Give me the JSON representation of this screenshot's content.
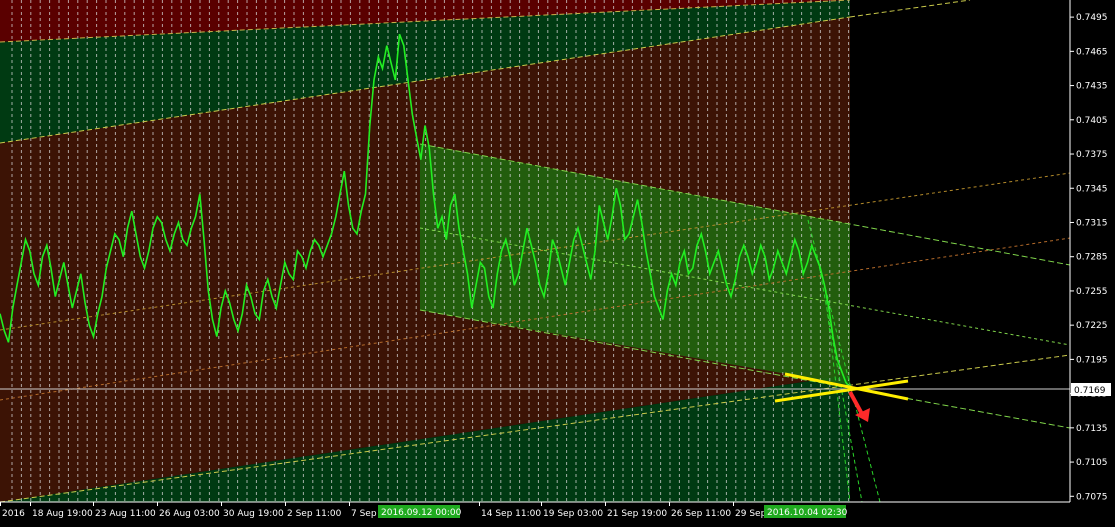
{
  "chart_data": {
    "type": "line",
    "instrument_series": "price",
    "ylim": [
      0.707,
      0.751
    ],
    "y_ticks": [
      "0.7495",
      "0.7465",
      "0.7435",
      "0.7405",
      "0.7375",
      "0.7345",
      "0.7315",
      "0.7285",
      "0.7255",
      "0.7225",
      "0.7195",
      "0.7165",
      "0.7135",
      "0.7105",
      "0.7075"
    ],
    "current_price": "0.7169",
    "x_ticks": [
      "2016",
      "18 Aug 19:00",
      "23 Aug 11:00",
      "26 Aug 03:00",
      "30 Aug 19:00",
      "2 Sep 11:00",
      "7 Sep 0",
      "14 Sep 11:00",
      "19 Sep 03:00",
      "21 Sep 19:00",
      "26 Sep 11:00",
      "29 Sep"
    ],
    "x_highlight_tags": [
      "2016.09.12 00:00",
      "2016.10.04 02:30"
    ],
    "grid": "vertical dashed",
    "price_y": [
      0.7235,
      0.722,
      0.721,
      0.724,
      0.726,
      0.728,
      0.73,
      0.729,
      0.727,
      0.726,
      0.7285,
      0.7295,
      0.7275,
      0.725,
      0.7265,
      0.728,
      0.726,
      0.724,
      0.7255,
      0.727,
      0.7245,
      0.7225,
      0.7215,
      0.7235,
      0.725,
      0.7275,
      0.729,
      0.7305,
      0.73,
      0.7285,
      0.731,
      0.7325,
      0.7305,
      0.7285,
      0.7275,
      0.729,
      0.731,
      0.732,
      0.7315,
      0.73,
      0.729,
      0.7305,
      0.7315,
      0.73,
      0.7295,
      0.731,
      0.732,
      0.734,
      0.73,
      0.7255,
      0.723,
      0.7215,
      0.724,
      0.7255,
      0.7245,
      0.723,
      0.722,
      0.7235,
      0.726,
      0.725,
      0.7235,
      0.723,
      0.7255,
      0.7265,
      0.725,
      0.724,
      0.726,
      0.728,
      0.727,
      0.7265,
      0.729,
      0.7285,
      0.7275,
      0.729,
      0.73,
      0.7295,
      0.7285,
      0.7295,
      0.7305,
      0.732,
      0.734,
      0.736,
      0.733,
      0.731,
      0.7305,
      0.7325,
      0.734,
      0.74,
      0.744,
      0.746,
      0.745,
      0.747,
      0.7455,
      0.744,
      0.748,
      0.747,
      0.744,
      0.741,
      0.739,
      0.737,
      0.74,
      0.738,
      0.734,
      0.731,
      0.732,
      0.73,
      0.733,
      0.734,
      0.731,
      0.729,
      0.727,
      0.724,
      0.726,
      0.728,
      0.7275,
      0.725,
      0.724,
      0.727,
      0.729,
      0.73,
      0.7285,
      0.726,
      0.727,
      0.729,
      0.731,
      0.7295,
      0.728,
      0.726,
      0.725,
      0.727,
      0.73,
      0.729,
      0.7275,
      0.726,
      0.728,
      0.73,
      0.731,
      0.7295,
      0.728,
      0.7265,
      0.729,
      0.733,
      0.7315,
      0.73,
      0.732,
      0.7345,
      0.733,
      0.73,
      0.7305,
      0.732,
      0.7335,
      0.7315,
      0.729,
      0.727,
      0.725,
      0.724,
      0.723,
      0.7255,
      0.727,
      0.726,
      0.728,
      0.729,
      0.727,
      0.7275,
      0.7295,
      0.7305,
      0.729,
      0.727,
      0.728,
      0.729,
      0.7275,
      0.726,
      0.725,
      0.7265,
      0.7285,
      0.7295,
      0.7285,
      0.727,
      0.728,
      0.7295,
      0.7285,
      0.7265,
      0.7275,
      0.729,
      0.728,
      0.727,
      0.7285,
      0.73,
      0.729,
      0.727,
      0.728,
      0.7295,
      0.7285,
      0.7275,
      0.726,
      0.724,
      0.7215,
      0.7195,
      0.7185,
      0.7175,
      0.717
    ]
  },
  "markers": {
    "down_arrow_color": "#ff2a2a",
    "cross_color": "#ffee00"
  }
}
